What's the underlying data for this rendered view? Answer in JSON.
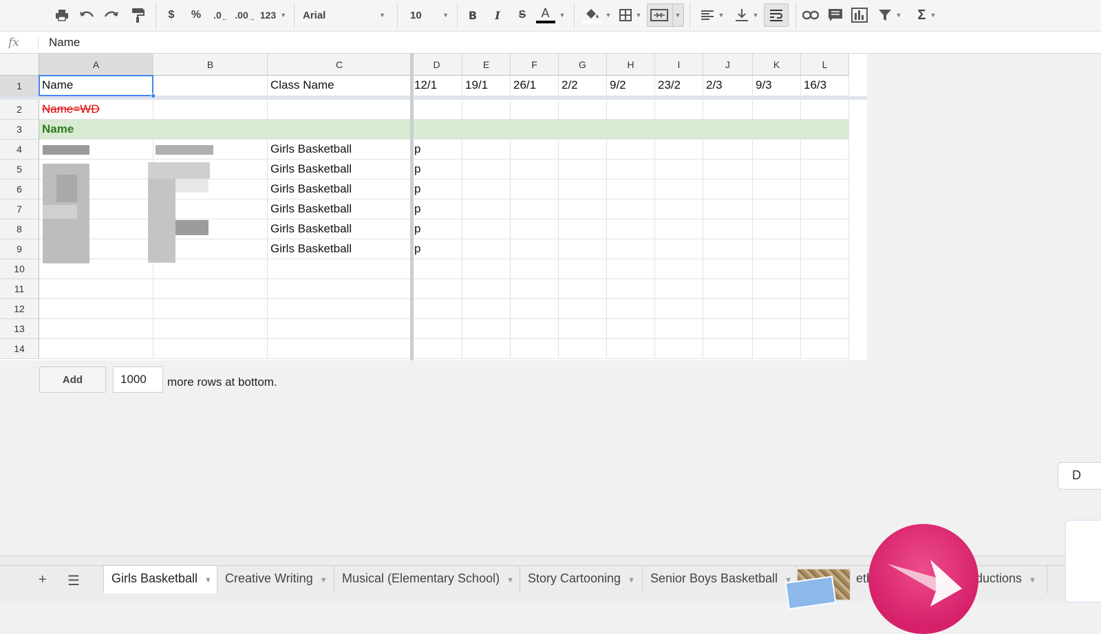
{
  "toolbar": {
    "format_123": "123",
    "currency": "$",
    "percent": "%",
    "decrease_decimals": ".0",
    "increase_decimals": ".00",
    "font_name": "Arial",
    "font_size": "10",
    "bold": "B",
    "italic": "I",
    "strike": "S",
    "text_color": "A",
    "functions": "Σ"
  },
  "formula_bar": {
    "fx": "fx",
    "value": "Name"
  },
  "columns": [
    "A",
    "B",
    "C",
    "D",
    "E",
    "F",
    "G",
    "H",
    "I",
    "J",
    "K",
    "L"
  ],
  "rows": [
    "1",
    "2",
    "3",
    "4",
    "5",
    "6",
    "7",
    "8",
    "9",
    "10",
    "11",
    "12",
    "13",
    "14"
  ],
  "header_row": {
    "a": "Name",
    "c": "Class Name",
    "dates": [
      "12/1",
      "19/1",
      "26/1",
      "2/2",
      "9/2",
      "23/2",
      "2/3",
      "9/3",
      "16/3"
    ]
  },
  "legend": {
    "withdrawn": "Name=WD",
    "section": "Name"
  },
  "students": [
    {
      "class": "Girls Basketball",
      "d": "p"
    },
    {
      "class": "Girls Basketball",
      "d": "p"
    },
    {
      "class": "Girls Basketball",
      "d": "p"
    },
    {
      "class": "Girls Basketball",
      "d": "p"
    },
    {
      "class": "Girls Basketball",
      "d": "p"
    },
    {
      "class": "Girls Basketball",
      "d": "p"
    }
  ],
  "add_rows": {
    "button": "Add",
    "count": "1000",
    "suffix": "more rows at bottom."
  },
  "sheet_tabs": [
    {
      "label": "Girls Basketball"
    },
    {
      "label": "Creative Writing"
    },
    {
      "label": "Musical (Elementary School)"
    },
    {
      "label": "Story Cartooning"
    },
    {
      "label": "Senior Boys Basketball"
    },
    {
      "label": "etb"
    },
    {
      "label": "ductions"
    }
  ],
  "side_widget": {
    "label": "D"
  },
  "colors": {
    "selection": "#4285f4",
    "withdrawn_text": "#e00000",
    "section_bg": "#d9ead3",
    "section_text": "#2d7a1f",
    "skitch": "#d6206a"
  }
}
